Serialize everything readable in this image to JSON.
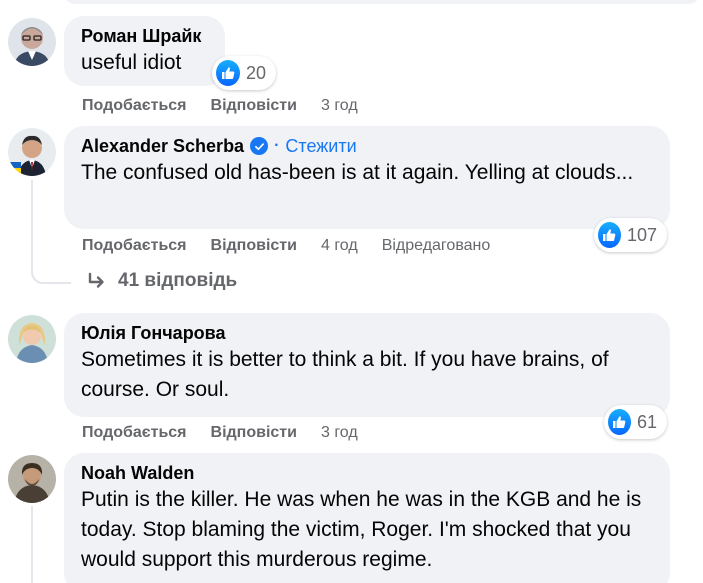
{
  "comments": [
    {
      "author": "Роман Шрайк",
      "text": "useful idiot",
      "reaction_count": "20",
      "like_label": "Подобається",
      "reply_label": "Відповісти",
      "time": "3 год"
    },
    {
      "author": "Alexander Scherba",
      "verified": true,
      "follow_label": "Стежити",
      "text": "The confused old has-been is at it again. Yelling at clouds...",
      "reaction_count": "107",
      "like_label": "Подобається",
      "reply_label": "Відповісти",
      "time": "4 год",
      "edited_label": "Відредаговано",
      "replies_label": "41 відповідь"
    },
    {
      "author": "Юлія Гончарова",
      "text": "Sometimes it is better to think a bit. If you have brains, of course. Or soul.",
      "reaction_count": "61",
      "like_label": "Подобається",
      "reply_label": "Відповісти",
      "time": "3 год"
    },
    {
      "author": "Noah Walden",
      "text": "Putin is the killer. He was when he was in the KGB and he is today. Stop blaming the victim, Roger. I'm shocked that you would support this murderous regime."
    }
  ],
  "colors": {
    "bubble": "#f0f2f5",
    "accent": "#1877f2",
    "secondary_text": "#65676b",
    "primary_text": "#050505"
  },
  "icons": {
    "like": "like-thumb-icon",
    "verified": "verified-badge-icon",
    "reply_arrow": "reply-arrow-icon"
  }
}
